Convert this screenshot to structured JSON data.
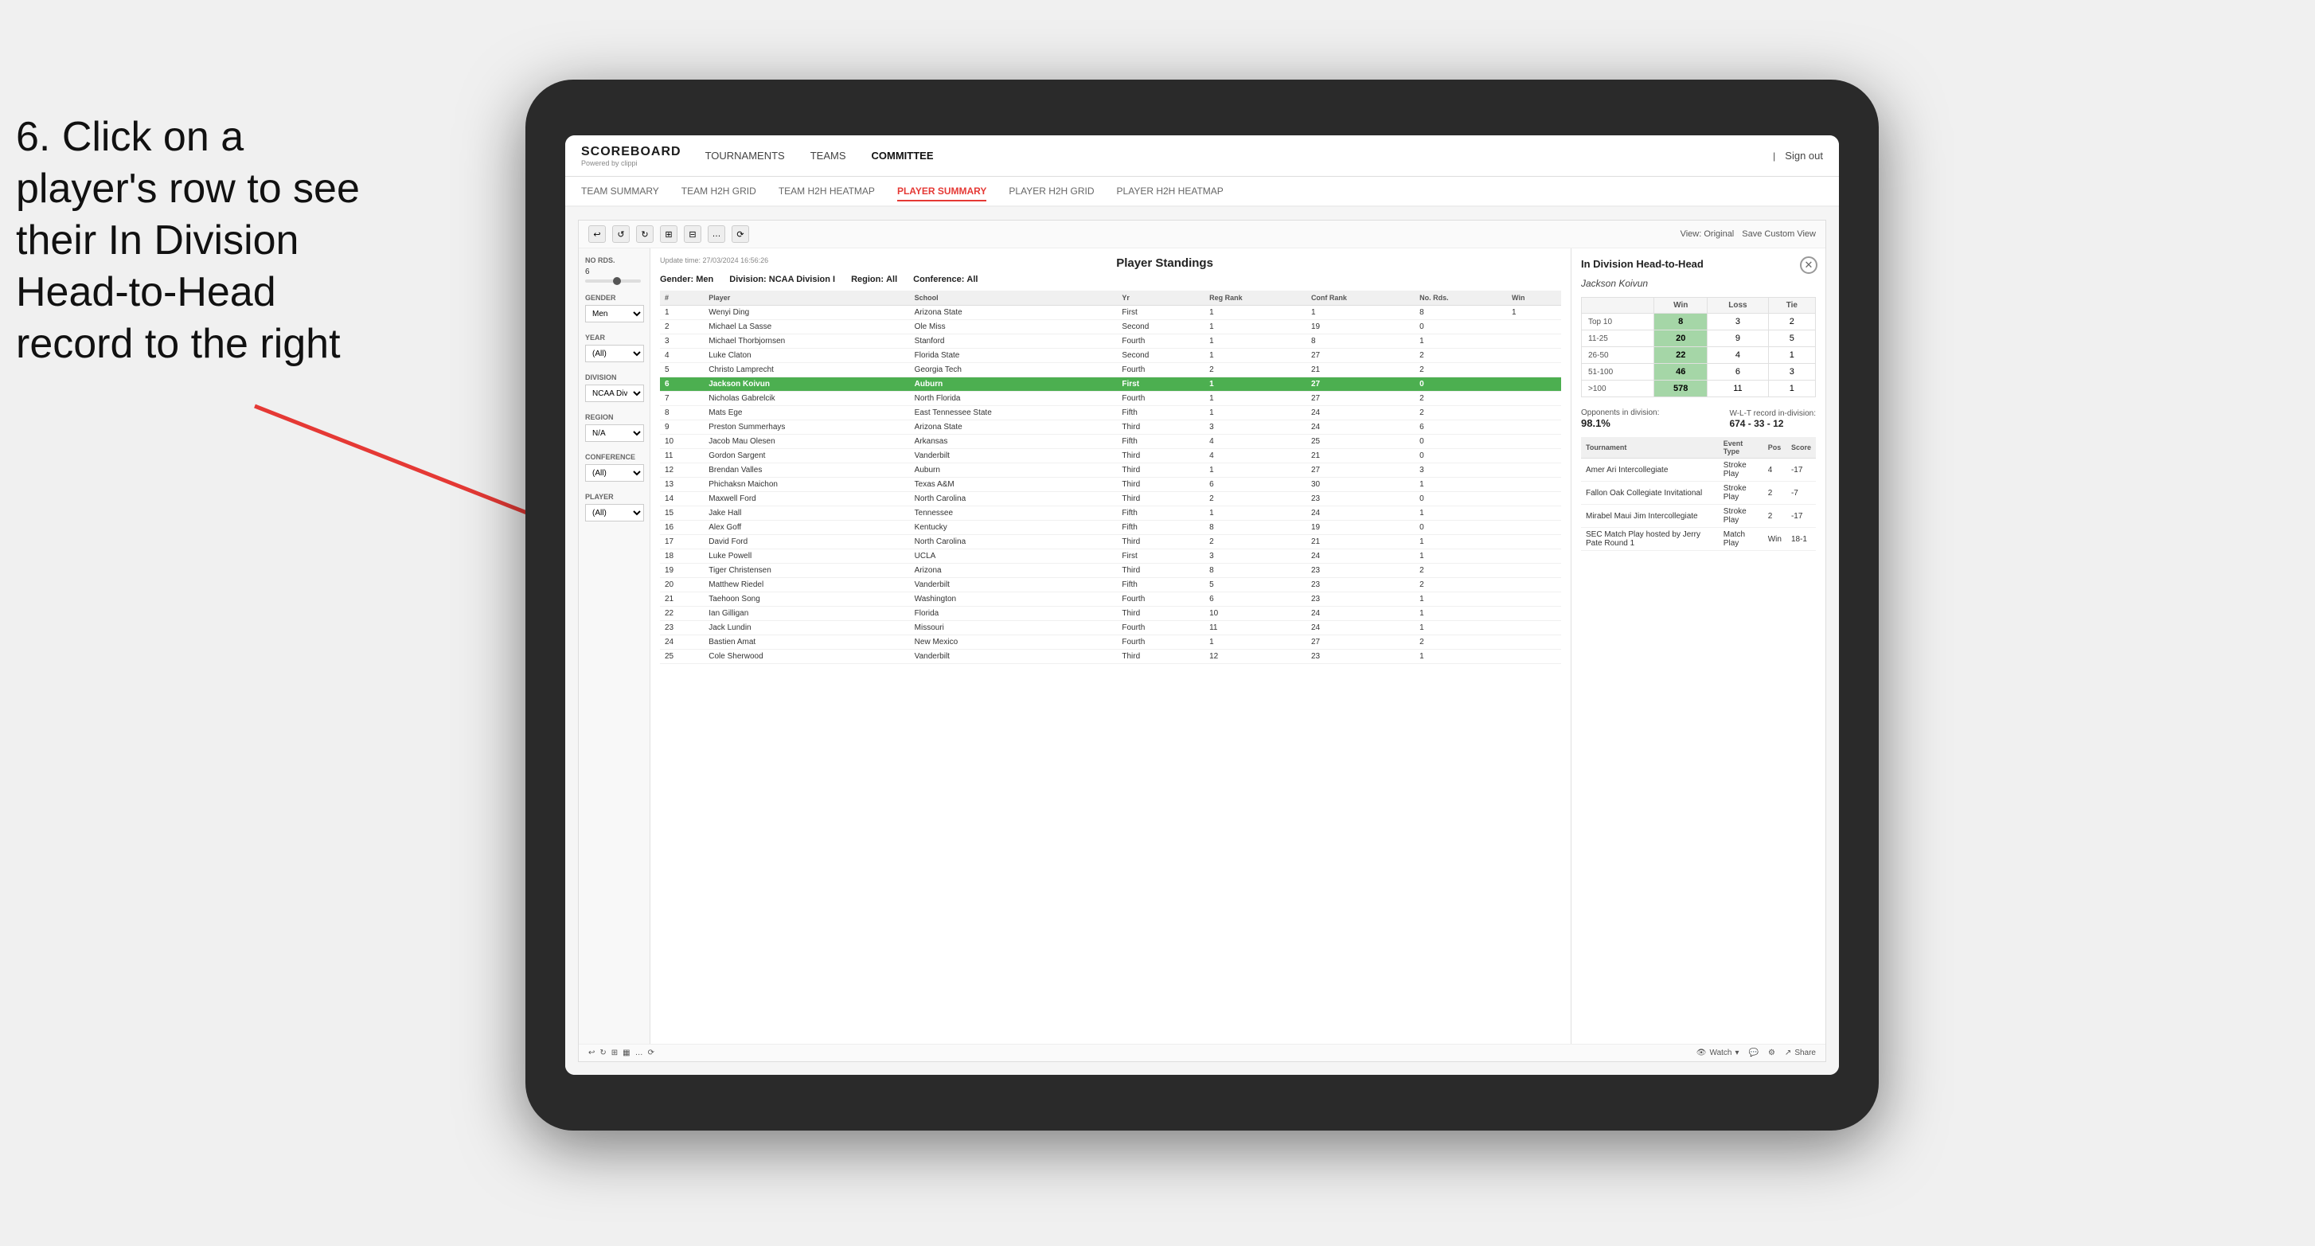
{
  "instruction": {
    "line1": "6. Click on a",
    "line2": "player's row to see",
    "line3": "their In Division",
    "line4": "Head-to-Head",
    "line5": "record to the right"
  },
  "nav": {
    "logo": "SCOREBOARD",
    "logo_sub": "Powered by clippi",
    "items": [
      "TOURNAMENTS",
      "TEAMS",
      "COMMITTEE"
    ],
    "sign_out": "Sign out"
  },
  "sub_nav": {
    "items": [
      "TEAM SUMMARY",
      "TEAM H2H GRID",
      "TEAM H2H HEATMAP",
      "PLAYER SUMMARY",
      "PLAYER H2H GRID",
      "PLAYER H2H HEATMAP"
    ],
    "active": "PLAYER SUMMARY"
  },
  "update": {
    "label": "Update time:",
    "value": "27/03/2024 16:56:26"
  },
  "standings": {
    "title": "Player Standings",
    "gender_label": "Gender:",
    "gender": "Men",
    "division_label": "Division:",
    "division": "NCAA Division I",
    "region_label": "Region:",
    "region": "All",
    "conference_label": "Conference:",
    "conference": "All",
    "columns": [
      "#",
      "Player",
      "School",
      "Yr",
      "Reg Rank",
      "Conf Rank",
      "No. Rds.",
      "Win"
    ],
    "rows": [
      {
        "num": "1",
        "player": "Wenyi Ding",
        "school": "Arizona State",
        "yr": "First",
        "reg": "1",
        "conf": "1",
        "rds": "8",
        "win": "1"
      },
      {
        "num": "2",
        "player": "Michael La Sasse",
        "school": "Ole Miss",
        "yr": "Second",
        "reg": "1",
        "conf": "19",
        "rds": "0",
        "win": ""
      },
      {
        "num": "3",
        "player": "Michael Thorbjornsen",
        "school": "Stanford",
        "yr": "Fourth",
        "reg": "1",
        "conf": "8",
        "rds": "1",
        "win": ""
      },
      {
        "num": "4",
        "player": "Luke Claton",
        "school": "Florida State",
        "yr": "Second",
        "reg": "1",
        "conf": "27",
        "rds": "2",
        "win": ""
      },
      {
        "num": "5",
        "player": "Christo Lamprecht",
        "school": "Georgia Tech",
        "yr": "Fourth",
        "reg": "2",
        "conf": "21",
        "rds": "2",
        "win": ""
      },
      {
        "num": "6",
        "player": "Jackson Koivun",
        "school": "Auburn",
        "yr": "First",
        "reg": "1",
        "conf": "27",
        "rds": "0",
        "win": "",
        "highlighted": true
      },
      {
        "num": "7",
        "player": "Nicholas Gabrelcik",
        "school": "North Florida",
        "yr": "Fourth",
        "reg": "1",
        "conf": "27",
        "rds": "2",
        "win": ""
      },
      {
        "num": "8",
        "player": "Mats Ege",
        "school": "East Tennessee State",
        "yr": "Fifth",
        "reg": "1",
        "conf": "24",
        "rds": "2",
        "win": ""
      },
      {
        "num": "9",
        "player": "Preston Summerhays",
        "school": "Arizona State",
        "yr": "Third",
        "reg": "3",
        "conf": "24",
        "rds": "6",
        "win": ""
      },
      {
        "num": "10",
        "player": "Jacob Mau Olesen",
        "school": "Arkansas",
        "yr": "Fifth",
        "reg": "4",
        "conf": "25",
        "rds": "0",
        "win": ""
      },
      {
        "num": "11",
        "player": "Gordon Sargent",
        "school": "Vanderbilt",
        "yr": "Third",
        "reg": "4",
        "conf": "21",
        "rds": "0",
        "win": ""
      },
      {
        "num": "12",
        "player": "Brendan Valles",
        "school": "Auburn",
        "yr": "Third",
        "reg": "1",
        "conf": "27",
        "rds": "3",
        "win": ""
      },
      {
        "num": "13",
        "player": "Phichaksn Maichon",
        "school": "Texas A&M",
        "yr": "Third",
        "reg": "6",
        "conf": "30",
        "rds": "1",
        "win": ""
      },
      {
        "num": "14",
        "player": "Maxwell Ford",
        "school": "North Carolina",
        "yr": "Third",
        "reg": "2",
        "conf": "23",
        "rds": "0",
        "win": ""
      },
      {
        "num": "15",
        "player": "Jake Hall",
        "school": "Tennessee",
        "yr": "Fifth",
        "reg": "1",
        "conf": "24",
        "rds": "1",
        "win": ""
      },
      {
        "num": "16",
        "player": "Alex Goff",
        "school": "Kentucky",
        "yr": "Fifth",
        "reg": "8",
        "conf": "19",
        "rds": "0",
        "win": ""
      },
      {
        "num": "17",
        "player": "David Ford",
        "school": "North Carolina",
        "yr": "Third",
        "reg": "2",
        "conf": "21",
        "rds": "1",
        "win": ""
      },
      {
        "num": "18",
        "player": "Luke Powell",
        "school": "UCLA",
        "yr": "First",
        "reg": "3",
        "conf": "24",
        "rds": "1",
        "win": ""
      },
      {
        "num": "19",
        "player": "Tiger Christensen",
        "school": "Arizona",
        "yr": "Third",
        "reg": "8",
        "conf": "23",
        "rds": "2",
        "win": ""
      },
      {
        "num": "20",
        "player": "Matthew Riedel",
        "school": "Vanderbilt",
        "yr": "Fifth",
        "reg": "5",
        "conf": "23",
        "rds": "2",
        "win": ""
      },
      {
        "num": "21",
        "player": "Taehoon Song",
        "school": "Washington",
        "yr": "Fourth",
        "reg": "6",
        "conf": "23",
        "rds": "1",
        "win": ""
      },
      {
        "num": "22",
        "player": "Ian Gilligan",
        "school": "Florida",
        "yr": "Third",
        "reg": "10",
        "conf": "24",
        "rds": "1",
        "win": ""
      },
      {
        "num": "23",
        "player": "Jack Lundin",
        "school": "Missouri",
        "yr": "Fourth",
        "reg": "11",
        "conf": "24",
        "rds": "1",
        "win": ""
      },
      {
        "num": "24",
        "player": "Bastien Amat",
        "school": "New Mexico",
        "yr": "Fourth",
        "reg": "1",
        "conf": "27",
        "rds": "2",
        "win": ""
      },
      {
        "num": "25",
        "player": "Cole Sherwood",
        "school": "Vanderbilt",
        "yr": "Third",
        "reg": "12",
        "conf": "23",
        "rds": "1",
        "win": ""
      }
    ]
  },
  "filters": {
    "no_rds_label": "No Rds.",
    "no_rds_value": "6",
    "gender_label": "Gender",
    "gender_value": "Men",
    "year_label": "Year",
    "year_value": "(All)",
    "division_label": "Division",
    "division_value": "NCAA Division I",
    "region_label": "Region",
    "region_value": "N/A",
    "conference_label": "Conference",
    "conference_value": "(All)",
    "player_label": "Player",
    "player_value": "(All)"
  },
  "h2h": {
    "title": "In Division Head-to-Head",
    "player": "Jackson Koivun",
    "col_win": "Win",
    "col_loss": "Loss",
    "col_tie": "Tie",
    "rows": [
      {
        "label": "Top 10",
        "win": "8",
        "loss": "3",
        "tie": "2"
      },
      {
        "label": "11-25",
        "win": "20",
        "loss": "9",
        "tie": "5"
      },
      {
        "label": "26-50",
        "win": "22",
        "loss": "4",
        "tie": "1"
      },
      {
        "label": "51-100",
        "win": "46",
        "loss": "6",
        "tie": "3"
      },
      {
        "label": ">100",
        "win": "578",
        "loss": "11",
        "tie": "1"
      }
    ],
    "opponents_label": "Opponents in division:",
    "opponents_pct": "98.1%",
    "wlt_label": "W-L-T record in-division:",
    "wlt": "674 - 33 - 12",
    "tournament_cols": [
      "Tournament",
      "Event Type",
      "Pos",
      "Score"
    ],
    "tournaments": [
      {
        "name": "Amer Ari Intercollegiate",
        "type": "Stroke Play",
        "pos": "4",
        "score": "-17"
      },
      {
        "name": "Fallon Oak Collegiate Invitational",
        "type": "Stroke Play",
        "pos": "2",
        "score": "-7"
      },
      {
        "name": "Mirabel Maui Jim Intercollegiate",
        "type": "Stroke Play",
        "pos": "2",
        "score": "-17"
      },
      {
        "name": "SEC Match Play hosted by Jerry Pate Round 1",
        "type": "Match Play",
        "pos": "Win",
        "score": "18-1"
      }
    ]
  },
  "toolbar": {
    "view_original": "View: Original",
    "save_custom": "Save Custom View",
    "watch": "Watch",
    "share": "Share"
  }
}
